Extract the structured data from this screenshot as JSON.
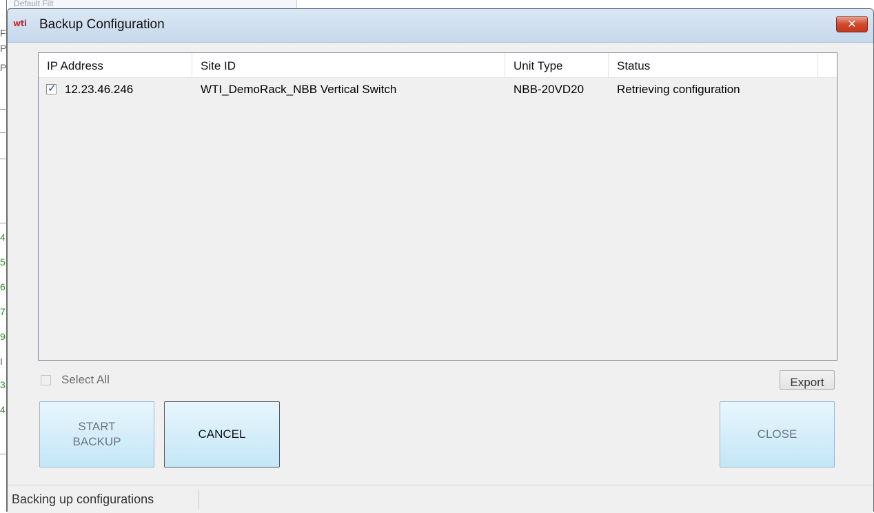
{
  "background": {
    "strip_text": "Default Filt",
    "side_glyphs": [
      "F",
      "P",
      "P",
      "4",
      "5",
      "6",
      "7",
      "9",
      "I",
      "3",
      "4"
    ]
  },
  "window": {
    "title": "Backup Configuration",
    "logo_text": "wti",
    "close_symbol": "✕"
  },
  "table": {
    "columns": [
      "IP Address",
      "Site ID",
      "Unit Type",
      "Status"
    ],
    "rows": [
      {
        "checked": true,
        "ip": "12.23.46.246",
        "site_id": "WTI_DemoRack_NBB Vertical Switch",
        "unit_type": "NBB-20VD20",
        "status": "Retrieving configuration"
      }
    ]
  },
  "controls": {
    "select_all_label": "Select All",
    "select_all_checked": false,
    "export_label": "Export",
    "start_backup_line1": "START",
    "start_backup_line2": "BACKUP",
    "cancel_label": "CANCEL",
    "close_label": "CLOSE"
  },
  "status_bar": {
    "text": "Backing up configurations"
  }
}
